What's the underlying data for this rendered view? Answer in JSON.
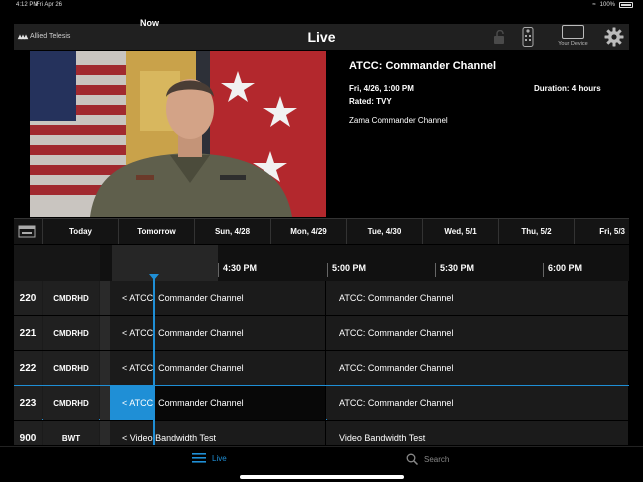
{
  "status_bar": {
    "time": "4:12 PM",
    "date": "Fri Apr 26",
    "battery": "100%"
  },
  "header": {
    "brand": "Allied Telesis",
    "title": "Live",
    "device_label": "Your Device"
  },
  "program": {
    "title": "ATCC: Commander Channel",
    "airtime": "Fri, 4/26, 1:00 PM",
    "duration": "Duration: 4 hours",
    "rating": "Rated: TVY",
    "description": "Zama Commander Channel"
  },
  "date_tabs": [
    "Today",
    "Tomorrow",
    "Sun, 4/28",
    "Mon, 4/29",
    "Tue, 4/30",
    "Wed, 5/1",
    "Thu, 5/2",
    "Fri, 5/3"
  ],
  "time_slots": {
    "now": "Now",
    "slots": [
      "4:30 PM",
      "5:00 PM",
      "5:30 PM",
      "6:00 PM"
    ]
  },
  "channels": [
    {
      "number": "220",
      "callsign": "CMDRHD",
      "current": "< ATCC: Commander Channel",
      "next": "ATCC: Commander Channel",
      "selected": false
    },
    {
      "number": "221",
      "callsign": "CMDRHD",
      "current": "< ATCC: Commander Channel",
      "next": "ATCC: Commander Channel",
      "selected": false
    },
    {
      "number": "222",
      "callsign": "CMDRHD",
      "current": "< ATCC: Commander Channel",
      "next": "ATCC: Commander Channel",
      "selected": false
    },
    {
      "number": "223",
      "callsign": "CMDRHD",
      "current": "< ATCC: Commander Channel",
      "next": "ATCC: Commander Channel",
      "selected": true,
      "progress": 0.2
    },
    {
      "number": "900",
      "callsign": "BWT",
      "current": "< Video Bandwidth Test",
      "next": "Video Bandwidth Test",
      "selected": false
    }
  ],
  "tabbar": {
    "live": "Live",
    "search": "Search"
  },
  "colors": {
    "accent": "#1f8fd6",
    "background": "#000000",
    "row": "#1b1b1b"
  },
  "icons": [
    "lock-icon",
    "remote-icon",
    "tablet-icon",
    "gear-icon",
    "calendar-icon",
    "list-icon",
    "search-icon"
  ]
}
